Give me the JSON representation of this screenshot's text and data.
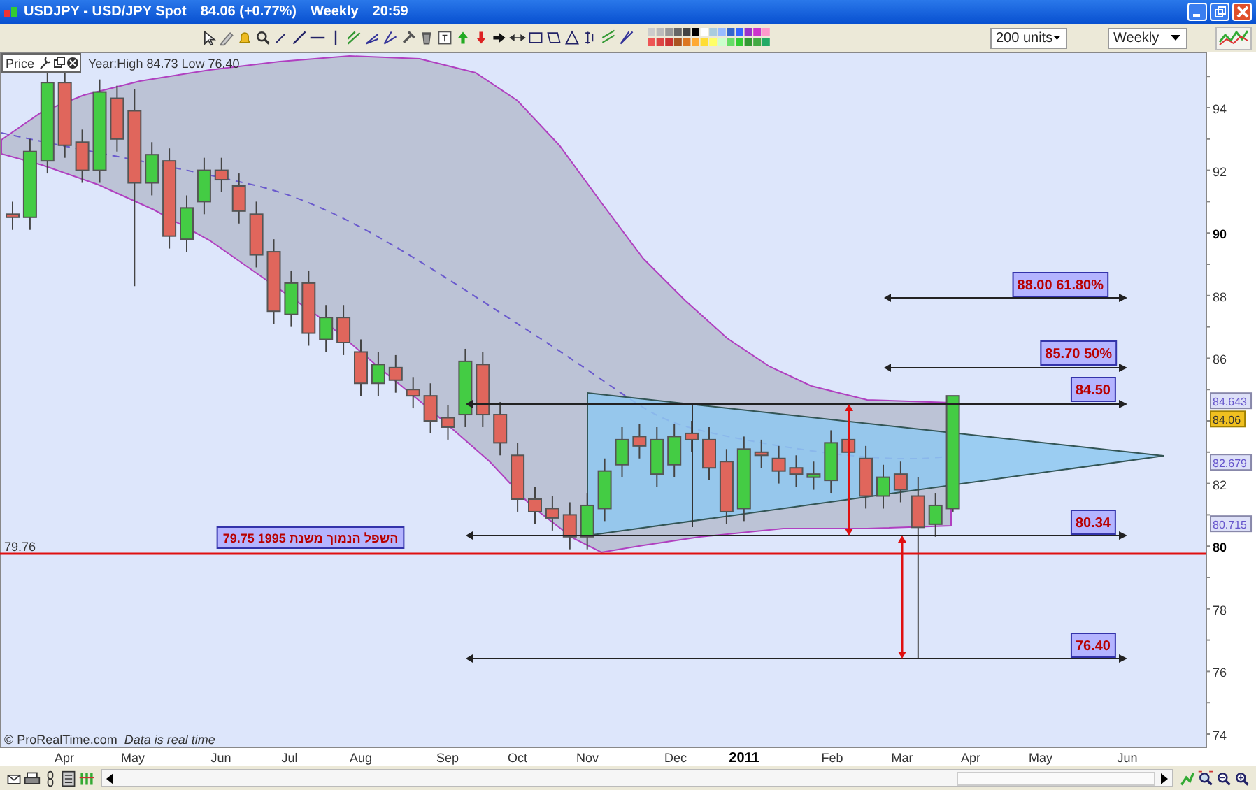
{
  "window": {
    "title": "USDJPY - USD/JPY Spot",
    "price": "84.06 (+0.77%)",
    "period": "Weekly",
    "time": "20:59"
  },
  "toolbar": {
    "units": "200 units",
    "timeframe": "Weekly"
  },
  "chart": {
    "panel_label": "Price",
    "range_info": "Year:High 84.73 Low 76.40",
    "footer": "© ProRealTime.com",
    "footer_note": "Data is real time",
    "y_ticks": [
      {
        "label": "94",
        "bold": false
      },
      {
        "label": "92",
        "bold": false
      },
      {
        "label": "90",
        "bold": true
      },
      {
        "label": "88",
        "bold": false
      },
      {
        "label": "86",
        "bold": false
      },
      {
        "label": "82",
        "bold": false
      },
      {
        "label": "80",
        "bold": true
      },
      {
        "label": "78",
        "bold": false
      },
      {
        "label": "76",
        "bold": false
      },
      {
        "label": "74",
        "bold": false
      }
    ],
    "x_labels": [
      {
        "label": "Apr",
        "bold": false
      },
      {
        "label": "May",
        "bold": false
      },
      {
        "label": "Jun",
        "bold": false
      },
      {
        "label": "Jul",
        "bold": false
      },
      {
        "label": "Aug",
        "bold": false
      },
      {
        "label": "Sep",
        "bold": false
      },
      {
        "label": "Oct",
        "bold": false
      },
      {
        "label": "Nov",
        "bold": false
      },
      {
        "label": "Dec",
        "bold": false
      },
      {
        "label": "2011",
        "bold": true
      },
      {
        "label": "Feb",
        "bold": false
      },
      {
        "label": "Mar",
        "bold": false
      },
      {
        "label": "Apr",
        "bold": false
      },
      {
        "label": "May",
        "bold": false
      },
      {
        "label": "Jun",
        "bold": false
      }
    ],
    "price_tags": [
      {
        "label": "84.643",
        "kind": "level"
      },
      {
        "label": "84.06",
        "kind": "last"
      },
      {
        "label": "82.679",
        "kind": "level"
      },
      {
        "label": "80.715",
        "kind": "level"
      }
    ],
    "support_line": {
      "label": "79.76"
    },
    "annotations": [
      {
        "label": "88.00  61.80%"
      },
      {
        "label": "85.70  50%"
      },
      {
        "label": "84.50"
      },
      {
        "label": "80.34"
      },
      {
        "label": "76.40"
      }
    ],
    "note": "השפל הנמוך משנת 1995  79.75"
  }
}
